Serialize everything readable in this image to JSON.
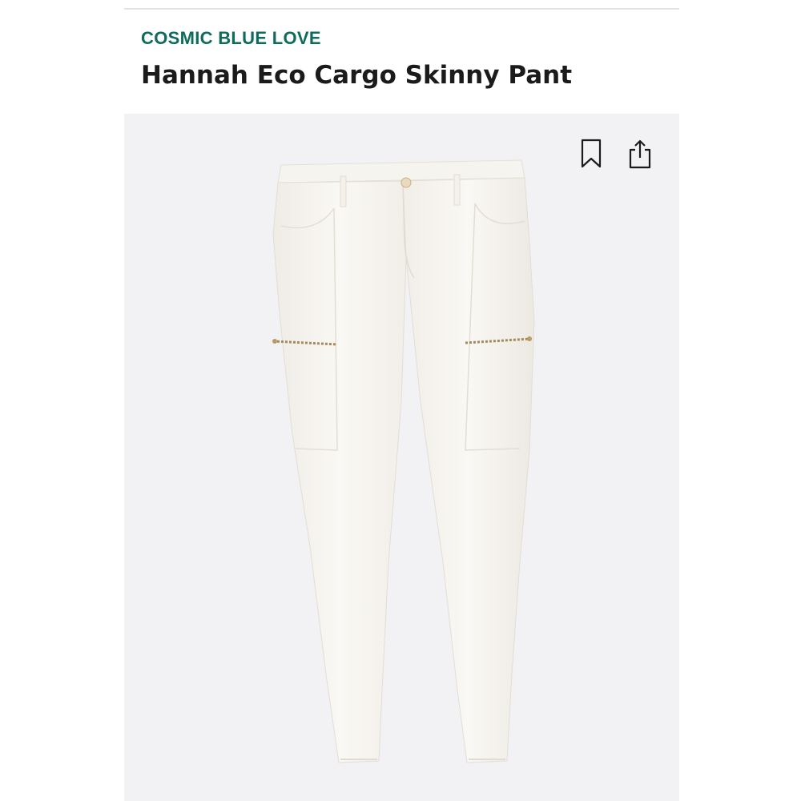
{
  "product": {
    "brand": "COSMIC BLUE LOVE",
    "title": "Hannah Eco Cargo Skinny Pant"
  },
  "actions": {
    "bookmark_icon": "bookmark-icon",
    "share_icon": "share-icon"
  },
  "colors": {
    "brand": "#0f6b5d",
    "title": "#1b1b1b",
    "image_background": "#f2f2f4",
    "garment": "#f8f6f1"
  }
}
